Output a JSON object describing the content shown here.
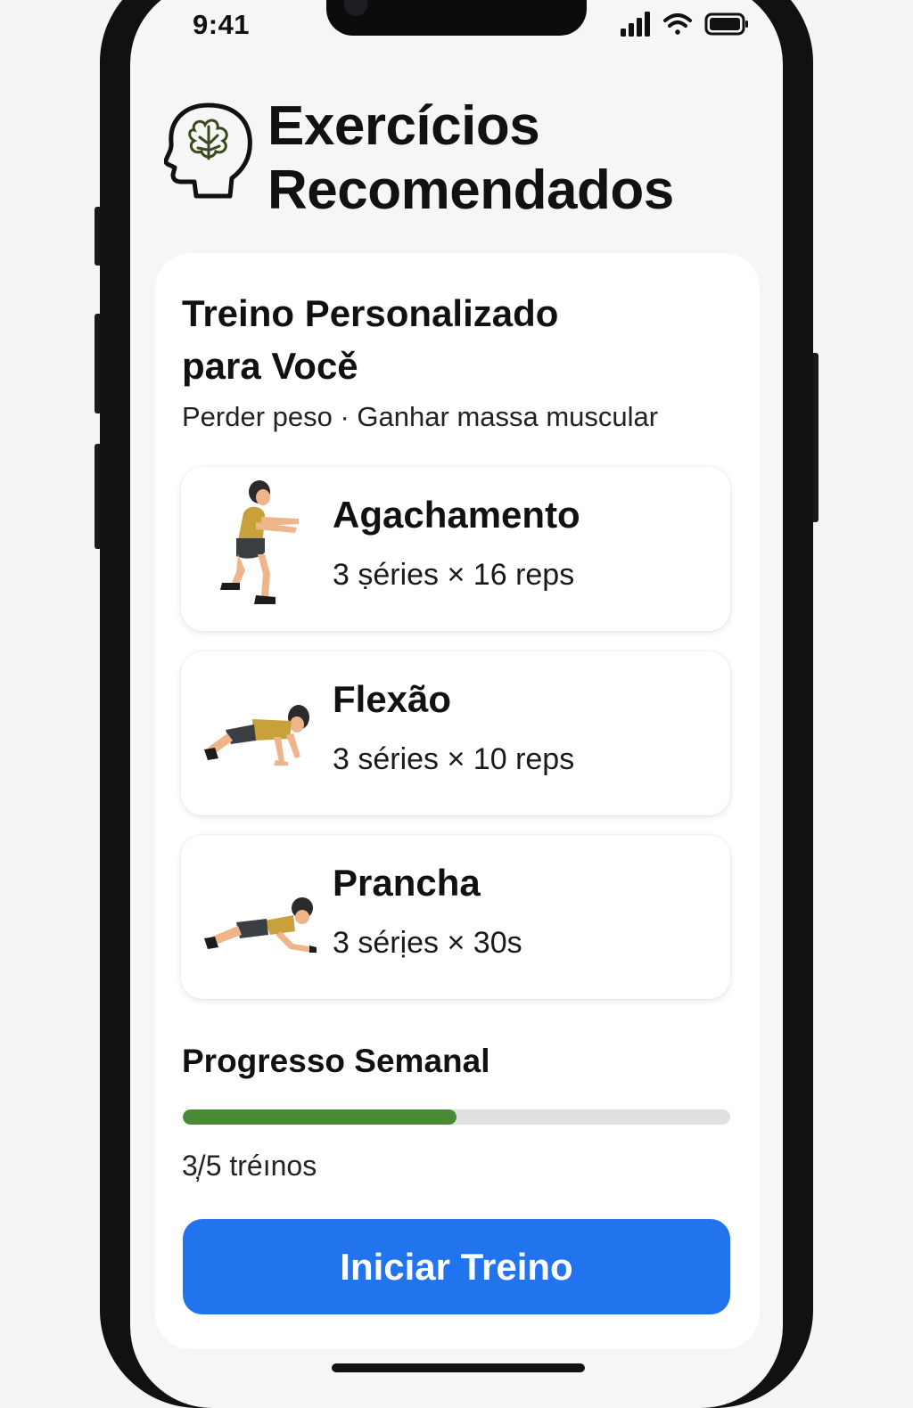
{
  "status_bar": {
    "time": "9:41",
    "icons": [
      "signal-icon",
      "wifi-icon",
      "battery-icon"
    ]
  },
  "header": {
    "icon": "brain-head-icon",
    "title_line1": "Exercícios",
    "title_line2": "Recomendados"
  },
  "plan": {
    "title_line1": "Treino Personalizado",
    "title_line2": "para Vocě",
    "goals": "Perder peso · Ganhar massa muscular"
  },
  "exercises": [
    {
      "name": "Agachamento",
      "detail": "3 ṣéries × 16 reps",
      "icon": "squat-figure-icon"
    },
    {
      "name": "Flexão",
      "detail": "3 séries × 10 reps",
      "icon": "pushup-figure-icon"
    },
    {
      "name": "Prancha",
      "detail": "3 sérịes × 30s",
      "icon": "plank-figure-icon"
    }
  ],
  "progress": {
    "title": "Progresso Semanal",
    "label": "3̦/5 tréınos",
    "completed": 3,
    "total": 5,
    "fill_fraction": 0.5
  },
  "start_button": {
    "label": "Iniciar Treino"
  },
  "colors": {
    "accent_blue": "#2174ee",
    "progress_green": "#4a8a35",
    "shirt_mustard": "#c9a13a"
  }
}
